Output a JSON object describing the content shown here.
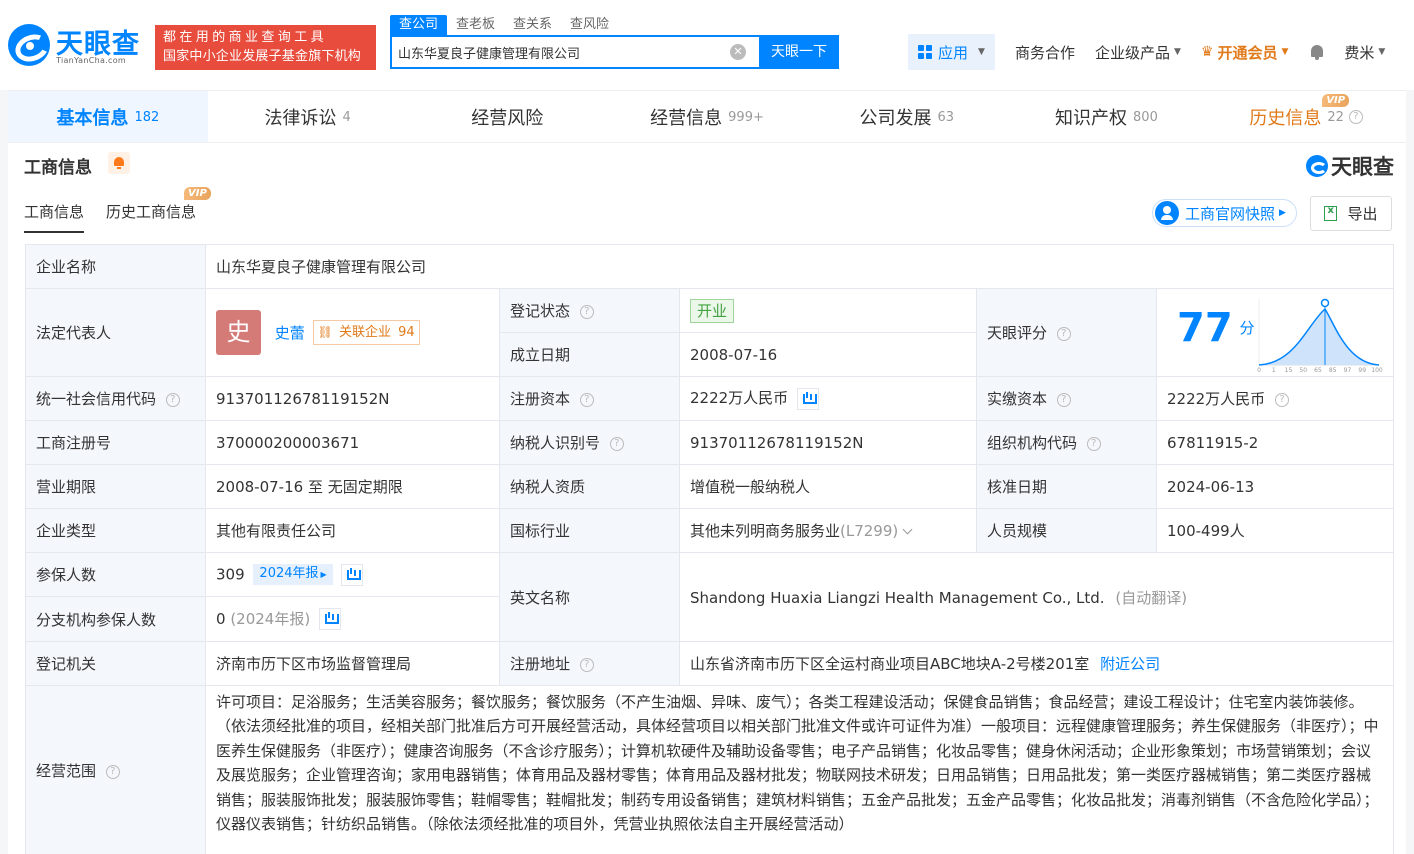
{
  "header": {
    "logo_text": "天眼查",
    "logo_sub": "TianYanCha.com",
    "slogan_line1": "都在用的商业查询工具",
    "slogan_line2": "国家中小企业发展子基金旗下机构",
    "search_tabs": [
      "查公司",
      "查老板",
      "查关系",
      "查风险"
    ],
    "search_value": "山东华夏良子健康管理有限公司",
    "search_button": "天眼一下",
    "nav": {
      "apps": "应用",
      "business": "商务合作",
      "enterprise": "企业级产品",
      "vip": "开通会员",
      "user": "费米"
    }
  },
  "main_tabs": [
    {
      "label": "基本信息",
      "count": "182"
    },
    {
      "label": "法律诉讼",
      "count": "4"
    },
    {
      "label": "经营风险",
      "count": ""
    },
    {
      "label": "经营信息",
      "count": "999+"
    },
    {
      "label": "公司发展",
      "count": "63"
    },
    {
      "label": "知识产权",
      "count": "800"
    },
    {
      "label": "历史信息",
      "count": "22"
    }
  ],
  "vip_badge": "VIP",
  "section": {
    "title": "工商信息",
    "brand": "天眼查",
    "sub_tabs": [
      "工商信息",
      "历史工商信息"
    ],
    "snapshot_button": "工商官网快照",
    "export_button": "导出"
  },
  "info": {
    "company_name_label": "企业名称",
    "company_name": "山东华夏良子健康管理有限公司",
    "legal_rep_label": "法定代表人",
    "legal_rep_avatar": "史",
    "legal_rep_name": "史蕾",
    "related_label": "关联企业",
    "related_count": "94",
    "status_label": "登记状态",
    "status": "开业",
    "established_label": "成立日期",
    "established": "2008-07-16",
    "score_label": "天眼评分",
    "score": "77",
    "score_unit": "分",
    "credit_code_label": "统一社会信用代码",
    "credit_code": "91370112678119152N",
    "reg_capital_label": "注册资本",
    "reg_capital": "2222万人民币",
    "paid_capital_label": "实缴资本",
    "paid_capital": "2222万人民币",
    "reg_no_label": "工商注册号",
    "reg_no": "370000200003671",
    "taxpayer_id_label": "纳税人识别号",
    "taxpayer_id": "91370112678119152N",
    "org_code_label": "组织机构代码",
    "org_code": "67811915-2",
    "term_label": "营业期限",
    "term": "2008-07-16 至 无固定期限",
    "tax_qual_label": "纳税人资质",
    "tax_qual": "增值税一般纳税人",
    "approval_label": "核准日期",
    "approval": "2024-06-13",
    "type_label": "企业类型",
    "type": "其他有限责任公司",
    "industry_label": "国标行业",
    "industry": "其他未列明商务服务业",
    "industry_code": "(L7299)",
    "staff_label": "人员规模",
    "staff": "100-499人",
    "insured_label": "参保人数",
    "insured": "309",
    "insured_year": "2024年报",
    "english_label": "英文名称",
    "english": "Shandong Huaxia Liangzi Health Management Co., Ltd.",
    "english_note": "(自动翻译)",
    "branch_insured_label": "分支机构参保人数",
    "branch_insured": "0",
    "branch_insured_note": "(2024年报)",
    "authority_label": "登记机关",
    "authority": "济南市历下区市场监督管理局",
    "address_label": "注册地址",
    "address": "山东省济南市历下区全运村商业项目ABC地块A-2号楼201室",
    "nearby": "附近公司",
    "scope_label": "经营范围",
    "scope": "许可项目：足浴服务；生活美容服务；餐饮服务；餐饮服务（不产生油烟、异味、废气）；各类工程建设活动；保健食品销售；食品经营；建设工程设计；住宅室内装饰装修。（依法须经批准的项目，经相关部门批准后方可开展经营活动，具体经营项目以相关部门批准文件或许可证件为准）一般项目：远程健康管理服务；养生保健服务（非医疗）；中医养生保健服务（非医疗）；健康咨询服务（不含诊疗服务）；计算机软硬件及辅助设备零售；电子产品销售；化妆品零售；健身休闲活动；企业形象策划；市场营销策划；会议及展览服务；企业管理咨询；家用电器销售；体育用品及器材零售；体育用品及器材批发；物联网技术研发；日用品销售；日用品批发；第一类医疗器械销售；第二类医疗器械销售；服装服饰批发；服装服饰零售；鞋帽零售；鞋帽批发；制药专用设备销售；建筑材料销售；五金产品批发；五金产品零售；化妆品批发；消毒剂销售（不含危险化学品）；仪器仪表销售；针纺织品销售。（除依法须经批准的项目外，凭营业执照依法自主开展经营活动）"
  },
  "score_chart": {
    "ticks": [
      "0",
      "1",
      "15",
      "50",
      "65",
      "85",
      "97",
      "99",
      "100"
    ]
  },
  "colors": {
    "accent": "#0084ff",
    "vip": "#e07a1a",
    "slogan_bg": "#e84c3d",
    "open_tag": "#44a244"
  }
}
